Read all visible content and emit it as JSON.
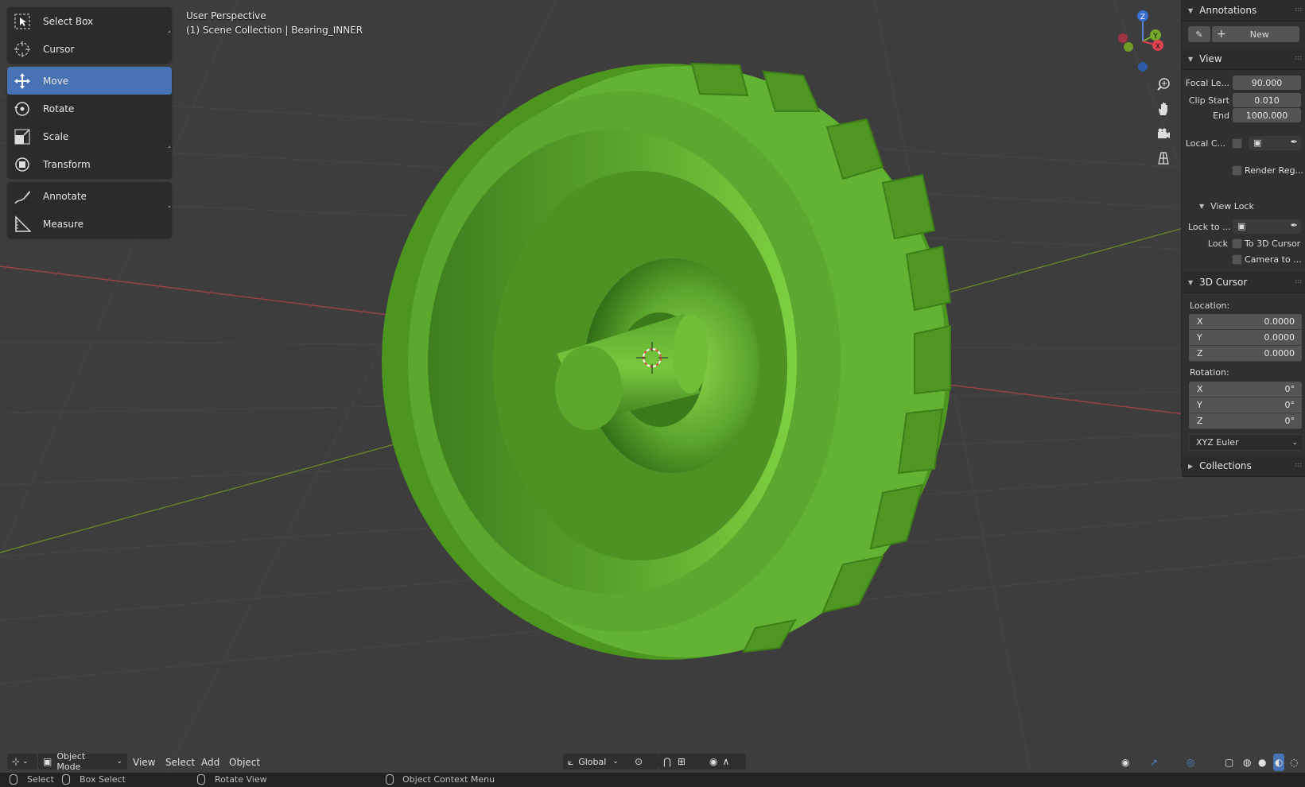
{
  "toolbar": {
    "groups": [
      [
        {
          "label": "Select Box",
          "icon": "select-box-icon"
        },
        {
          "label": "Cursor",
          "icon": "cursor-icon"
        }
      ],
      [
        {
          "label": "Move",
          "icon": "move-icon",
          "active": true
        },
        {
          "label": "Rotate",
          "icon": "rotate-icon"
        },
        {
          "label": "Scale",
          "icon": "scale-icon"
        },
        {
          "label": "Transform",
          "icon": "transform-icon"
        }
      ],
      [
        {
          "label": "Annotate",
          "icon": "annotate-icon"
        },
        {
          "label": "Measure",
          "icon": "measure-icon"
        }
      ]
    ]
  },
  "viewport": {
    "perspective": "User Perspective",
    "collection": "(1) Scene Collection | Bearing_INNER",
    "model_color": "#5fb030",
    "background": "#3d3d3d"
  },
  "gizmo": {
    "z": "Z",
    "y": "Y",
    "x": "X"
  },
  "sidebar": {
    "annotations": {
      "title": "Annotations",
      "new_label": "New"
    },
    "view": {
      "title": "View",
      "focal_label": "Focal Le...",
      "focal_value": "90.000",
      "clip_start_label": "Clip Start",
      "clip_start_value": "0.010",
      "end_label": "End",
      "end_value": "1000.000",
      "local_camera_label": "Local C...",
      "render_region_label": "Render Reg..."
    },
    "view_lock": {
      "title": "View Lock",
      "lock_to_label": "Lock to ...",
      "lock_label": "Lock",
      "to_3d_cursor": "To 3D Cursor",
      "camera_to": "Camera to ..."
    },
    "cursor": {
      "title": "3D Cursor",
      "location_label": "Location:",
      "loc_x": "0.0000",
      "loc_y": "0.0000",
      "loc_z": "0.0000",
      "rotation_label": "Rotation:",
      "rot_x": "0°",
      "rot_y": "0°",
      "rot_z": "0°",
      "mode": "XYZ Euler"
    },
    "collections": {
      "title": "Collections"
    }
  },
  "header": {
    "mode": "Object Mode",
    "menus": [
      "View",
      "Select",
      "Add",
      "Object"
    ],
    "orientation": "Global"
  },
  "status": {
    "select": "Select",
    "box_select": "Box Select",
    "rotate_view": "Rotate View",
    "context_menu": "Object Context Menu"
  }
}
